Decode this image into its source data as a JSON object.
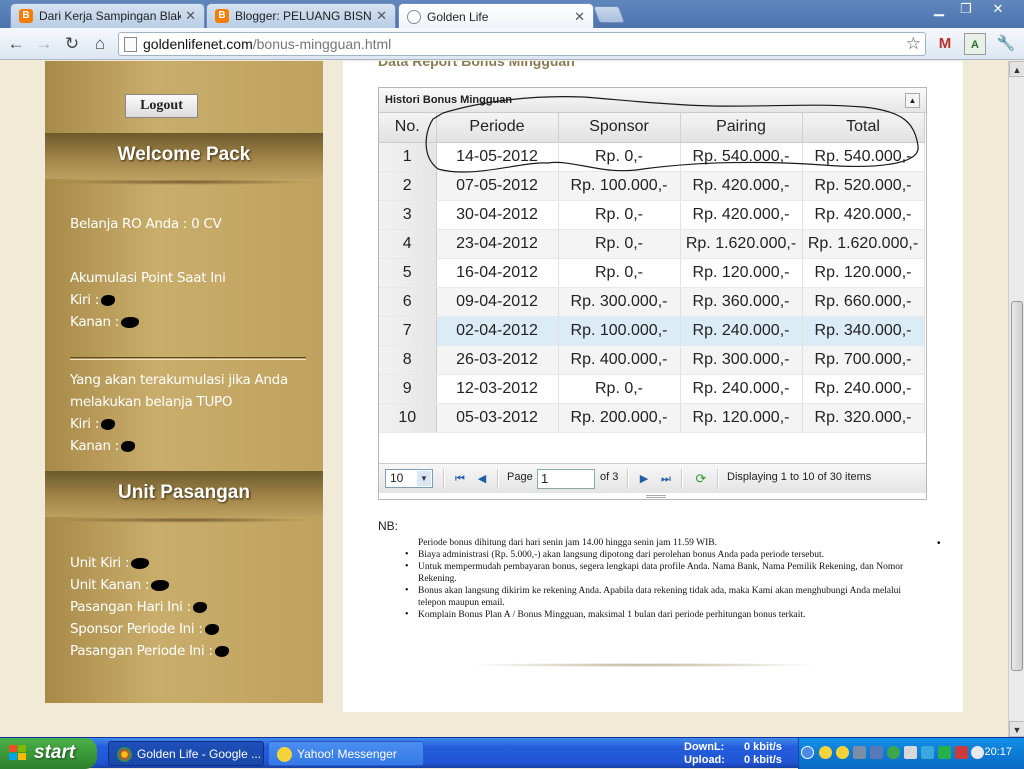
{
  "browser": {
    "tabs": [
      {
        "label": "Dari Kerja Sampingan BlakBlak",
        "icon": "blogger-icon"
      },
      {
        "label": "Blogger: PELUANG BISNIS DAI",
        "icon": "blogger-icon"
      },
      {
        "label": "Golden Life",
        "icon": "globe-icon",
        "active": true
      }
    ],
    "url_host": "goldenlifenet.com",
    "url_path": "/bonus-mingguan.html"
  },
  "sidebar": {
    "logout_label": "Logout",
    "welcome_title": "Welcome Pack",
    "belanja_ro": "Belanja RO Anda : 0 CV",
    "akumulasi_title": "Akumulasi Point Saat Ini",
    "kiri_label": "Kiri :",
    "kanan_label": "Kanan :",
    "tupo_text_1": "Yang akan terakumulasi jika Anda",
    "tupo_text_2": "melakukan belanja TUPO",
    "unit_title": "Unit Pasangan",
    "unit_items": [
      "Unit Kiri :",
      "Unit Kanan :",
      "Pasangan Hari Ini :",
      "Sponsor Periode Ini :",
      "Pasangan Periode Ini :"
    ]
  },
  "main": {
    "heading": "Data Report Bonus Mingguan",
    "grid_title": "Histori Bonus Mingguan",
    "columns": [
      "No.",
      "Periode",
      "Sponsor",
      "Pairing",
      "Total"
    ],
    "rows": [
      [
        "1",
        "14-05-2012",
        "Rp. 0,-",
        "Rp. 540.000,-",
        "Rp. 540.000,-"
      ],
      [
        "2",
        "07-05-2012",
        "Rp. 100.000,-",
        "Rp. 420.000,-",
        "Rp. 520.000,-"
      ],
      [
        "3",
        "30-04-2012",
        "Rp. 0,-",
        "Rp. 420.000,-",
        "Rp. 420.000,-"
      ],
      [
        "4",
        "23-04-2012",
        "Rp. 0,-",
        "Rp. 1.620.000,-",
        "Rp. 1.620.000,-"
      ],
      [
        "5",
        "16-04-2012",
        "Rp. 0,-",
        "Rp. 120.000,-",
        "Rp. 120.000,-"
      ],
      [
        "6",
        "09-04-2012",
        "Rp. 300.000,-",
        "Rp. 360.000,-",
        "Rp. 660.000,-"
      ],
      [
        "7",
        "02-04-2012",
        "Rp. 100.000,-",
        "Rp. 240.000,-",
        "Rp. 340.000,-"
      ],
      [
        "8",
        "26-03-2012",
        "Rp. 400.000,-",
        "Rp. 300.000,-",
        "Rp. 700.000,-"
      ],
      [
        "9",
        "12-03-2012",
        "Rp. 0,-",
        "Rp. 240.000,-",
        "Rp. 240.000,-"
      ],
      [
        "10",
        "05-03-2012",
        "Rp. 200.000,-",
        "Rp. 120.000,-",
        "Rp. 320.000,-"
      ]
    ],
    "selected_row": 7,
    "pager": {
      "page_size": "10",
      "page_label": "Page",
      "page_value": "1",
      "of_label": "of 3",
      "display_text": "Displaying 1 to 10 of 30 items"
    },
    "nb_label": "NB:",
    "notes": [
      "Periode bonus dihitung dari hari senin jam 14.00 hingga senin jam 11.59 WIB.",
      "Biaya administrasi (Rp. 5.000,-) akan langsung dipotong dari perolehan bonus Anda pada periode tersebut.",
      "Untuk mempermudah pembayaran bonus, segera lengkapi data profile Anda. Nama Bank, Nama Pemilik Rekening, dan Nomor Rekening.",
      "Bonus akan langsung dikirim ke rekening Anda. Apabila data rekening tidak ada, maka Kami akan menghubungi Anda melalui telepon maupun email.",
      "Komplain Bonus Plan A / Bonus Mingguan, maksimal 1 bulan dari periode perhitungan bonus terkait."
    ]
  },
  "taskbar": {
    "start_label": "start",
    "tasks": [
      "Golden Life - Google ...",
      "Yahoo! Messenger"
    ],
    "down_label": "DownL:",
    "down_value": "0 kbit/s",
    "up_label": "Upload:",
    "up_value": "0 kbit/s",
    "clock": "20:17"
  },
  "colors": {
    "sidebar_gold": "#c9ad6b",
    "grid_selected": "#dcecf6",
    "annotation": "#1a1a1a"
  }
}
